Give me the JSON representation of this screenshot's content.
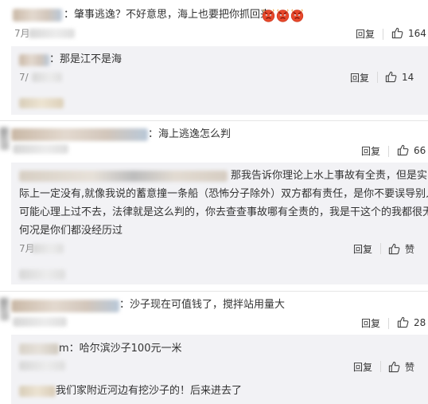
{
  "reply_label": "回复",
  "comments": [
    {
      "text": "：肇事逃逸？不好意思，海上也要把你抓回来。",
      "date": "7月",
      "likes": "164",
      "emojis": [
        "angry-face-icon",
        "angry-face-icon",
        "angry-face-icon"
      ],
      "replies": [
        {
          "text": "：那是江不是海",
          "date": "7/",
          "likes": "14"
        }
      ]
    },
    {
      "text": "：海上逃逸怎么判",
      "likes": "66",
      "replies": [
        {
          "lines": [
            "那我告诉你理论上水上事故有全责，但是实",
            "际上一定没有,就像我说的蓄意撞一条船（恐怖分子除外）双方都有责任，是你不要误导别人，",
            "可能心理上过不去，法律就是这么判的，你去查查事故哪有全责的，我是干这个的我都很无奈",
            "何况是你们都没经历过"
          ],
          "date": "7月",
          "likes": "赞"
        }
      ]
    },
    {
      "text": "：沙子现在可值钱了，搅拌站用量大",
      "likes": "28",
      "replies": [
        {
          "text": "m：哈尔滨沙子100元一米",
          "likes": "赞"
        },
        {
          "text": "我们家附近河边有挖沙子的！后来进去了"
        }
      ]
    }
  ],
  "colors": {
    "panel": "#f2f2f5",
    "text": "#333333",
    "emoji": "#e8492b"
  }
}
